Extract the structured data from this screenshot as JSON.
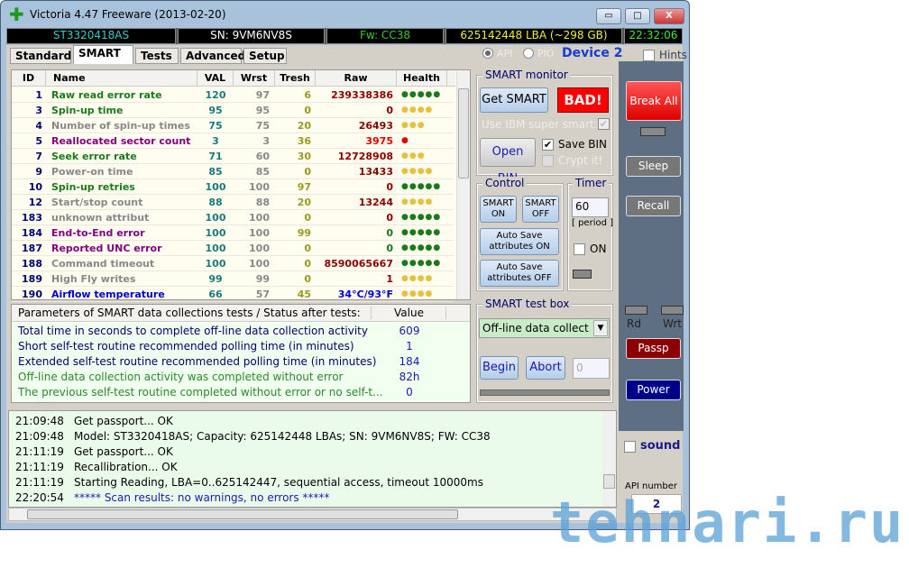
{
  "window": {
    "title": "Victoria 4.47  Freeware (2013-02-20)",
    "minimize": "▭",
    "maximize": "□",
    "close": "X"
  },
  "info": {
    "model": "ST3320418AS",
    "serial": "SN: 9VM6NV8S",
    "firmware": "Fw: CC38",
    "lba": "625142448 LBA (~298 GB)",
    "clock": "22:32:06"
  },
  "tabs": [
    "Standard",
    "SMART",
    "Tests",
    "Advanced",
    "Setup"
  ],
  "mode": {
    "api": "API",
    "pio": "PIO",
    "device": "Device 2",
    "hints": "Hints"
  },
  "smart_table": {
    "headers": [
      "ID",
      "Name",
      "VAL",
      "Wrst",
      "Tresh",
      "Raw",
      "Health"
    ],
    "rows": [
      {
        "id": "1",
        "name": "Raw read error rate",
        "val": "120",
        "wrst": "97",
        "tresh": "6",
        "raw": "239338386",
        "health": "●●●●●",
        "nc": "#1a7a1a",
        "rc": "#8b0000",
        "hc": "#1a7a1a"
      },
      {
        "id": "3",
        "name": "Spin-up time",
        "val": "95",
        "wrst": "95",
        "tresh": "0",
        "raw": "0",
        "health": "●●●●",
        "nc": "#1a7a1a",
        "rc": "#8b0000",
        "hc": "#e8c040"
      },
      {
        "id": "4",
        "name": "Number of spin-up times",
        "val": "75",
        "wrst": "75",
        "tresh": "20",
        "raw": "26493",
        "health": "●●●",
        "nc": "#888888",
        "rc": "#8b0000",
        "hc": "#e8c040"
      },
      {
        "id": "5",
        "name": "Reallocated sector count",
        "val": "3",
        "wrst": "3",
        "tresh": "36",
        "raw": "3975",
        "health": "●",
        "nc": "#800080",
        "rc": "#e00000",
        "hc": "#e00000"
      },
      {
        "id": "7",
        "name": "Seek error rate",
        "val": "71",
        "wrst": "60",
        "tresh": "30",
        "raw": "12728908",
        "health": "●●●",
        "nc": "#1a7a1a",
        "rc": "#8b0000",
        "hc": "#e8c040"
      },
      {
        "id": "9",
        "name": "Power-on time",
        "val": "85",
        "wrst": "85",
        "tresh": "0",
        "raw": "13433",
        "health": "●●●●",
        "nc": "#888888",
        "rc": "#8b0000",
        "hc": "#e8c040"
      },
      {
        "id": "10",
        "name": "Spin-up retries",
        "val": "100",
        "wrst": "100",
        "tresh": "97",
        "raw": "0",
        "health": "●●●●●",
        "nc": "#1a7a1a",
        "rc": "#8b0000",
        "hc": "#1a7a1a"
      },
      {
        "id": "12",
        "name": "Start/stop count",
        "val": "88",
        "wrst": "88",
        "tresh": "20",
        "raw": "13244",
        "health": "●●●●",
        "nc": "#888888",
        "rc": "#8b0000",
        "hc": "#e8c040"
      },
      {
        "id": "183",
        "name": "unknown attribut",
        "val": "100",
        "wrst": "100",
        "tresh": "0",
        "raw": "0",
        "health": "●●●●●",
        "nc": "#888888",
        "rc": "#8b0000",
        "hc": "#1a7a1a"
      },
      {
        "id": "184",
        "name": "End-to-End error",
        "val": "100",
        "wrst": "100",
        "tresh": "99",
        "raw": "0",
        "health": "●●●●●",
        "nc": "#800080",
        "rc": "#1a7a1a",
        "hc": "#1a7a1a"
      },
      {
        "id": "187",
        "name": "Reported UNC error",
        "val": "100",
        "wrst": "100",
        "tresh": "0",
        "raw": "0",
        "health": "●●●●●",
        "nc": "#800080",
        "rc": "#1a7a1a",
        "hc": "#1a7a1a"
      },
      {
        "id": "188",
        "name": "Command timeout",
        "val": "100",
        "wrst": "100",
        "tresh": "0",
        "raw": "8590065667",
        "health": "●●●●●",
        "nc": "#888888",
        "rc": "#8b0000",
        "hc": "#1a7a1a"
      },
      {
        "id": "189",
        "name": "High Fly writes",
        "val": "99",
        "wrst": "99",
        "tresh": "0",
        "raw": "1",
        "health": "●●●●",
        "nc": "#888888",
        "rc": "#8b0000",
        "hc": "#e8c040"
      },
      {
        "id": "190",
        "name": "Airflow temperature",
        "val": "66",
        "wrst": "57",
        "tresh": "45",
        "raw": "34°C/93°F",
        "health": "●●●●",
        "nc": "#0000cc",
        "rc": "#0000cc",
        "hc": "#e8c040"
      }
    ]
  },
  "params": {
    "header": "Parameters of SMART data collections tests / Status after tests:",
    "value_header": "Value",
    "rows": [
      {
        "label": "Total time in seconds to complete off-line data collection activity",
        "value": "609",
        "c": "#00006a"
      },
      {
        "label": "Short self-test routine recommended polling time (in minutes)",
        "value": "1",
        "c": "#00006a"
      },
      {
        "label": "Extended self-test routine recommended polling time (in minutes)",
        "value": "184",
        "c": "#00006a"
      },
      {
        "label": "Off-line data collection activity was completed without error",
        "value": "82h",
        "c": "#2a8a2a"
      },
      {
        "label": "The previous self-test routine completed without error or no self-t...",
        "value": "0",
        "c": "#2a8a2a"
      }
    ]
  },
  "smart_monitor": {
    "title": "SMART monitor",
    "get_smart": "Get SMART",
    "status": "BAD!",
    "ibm": "Use IBM super smart:",
    "open_bin": "Open BIN",
    "save_bin": "Save BIN",
    "crypt": "Crypt it!"
  },
  "control": {
    "title": "Control",
    "smart_on": "SMART ON",
    "smart_off": "SMART OFF",
    "auto_on": "Auto Save attributes ON",
    "auto_off": "Auto Save attributes OFF"
  },
  "timer": {
    "title": "Timer",
    "value": "60",
    "period": "[ period ]",
    "on": "ON"
  },
  "test_box": {
    "title": "SMART test box",
    "selected": "Off-line data collect",
    "begin": "Begin",
    "abort": "Abort",
    "value": "0"
  },
  "side": {
    "break_all": "Break All",
    "sleep": "Sleep",
    "recall": "Recall",
    "rd": "Rd",
    "wrt": "Wrt",
    "passp": "Passp",
    "power": "Power",
    "sound": "sound",
    "api_number_label": "API number",
    "api_number": "2"
  },
  "log": [
    {
      "t": "21:09:48",
      "m": "Get passport... OK",
      "c": "#000"
    },
    {
      "t": "21:09:48",
      "m": "Model: ST3320418AS; Capacity: 625142448 LBAs; SN: 9VM6NV8S; FW: CC38",
      "c": "#000"
    },
    {
      "t": "21:11:19",
      "m": "Get passport... OK",
      "c": "#000"
    },
    {
      "t": "21:11:19",
      "m": "Recallibration... OK",
      "c": "#000"
    },
    {
      "t": "21:11:19",
      "m": "Starting Reading, LBA=0..625142447, sequential access, timeout 10000ms",
      "c": "#000"
    },
    {
      "t": "22:20:54",
      "m": "***** Scan results: no warnings, no errors *****",
      "c": "#1a1aaa"
    }
  ],
  "watermark": "tehnari.ru"
}
